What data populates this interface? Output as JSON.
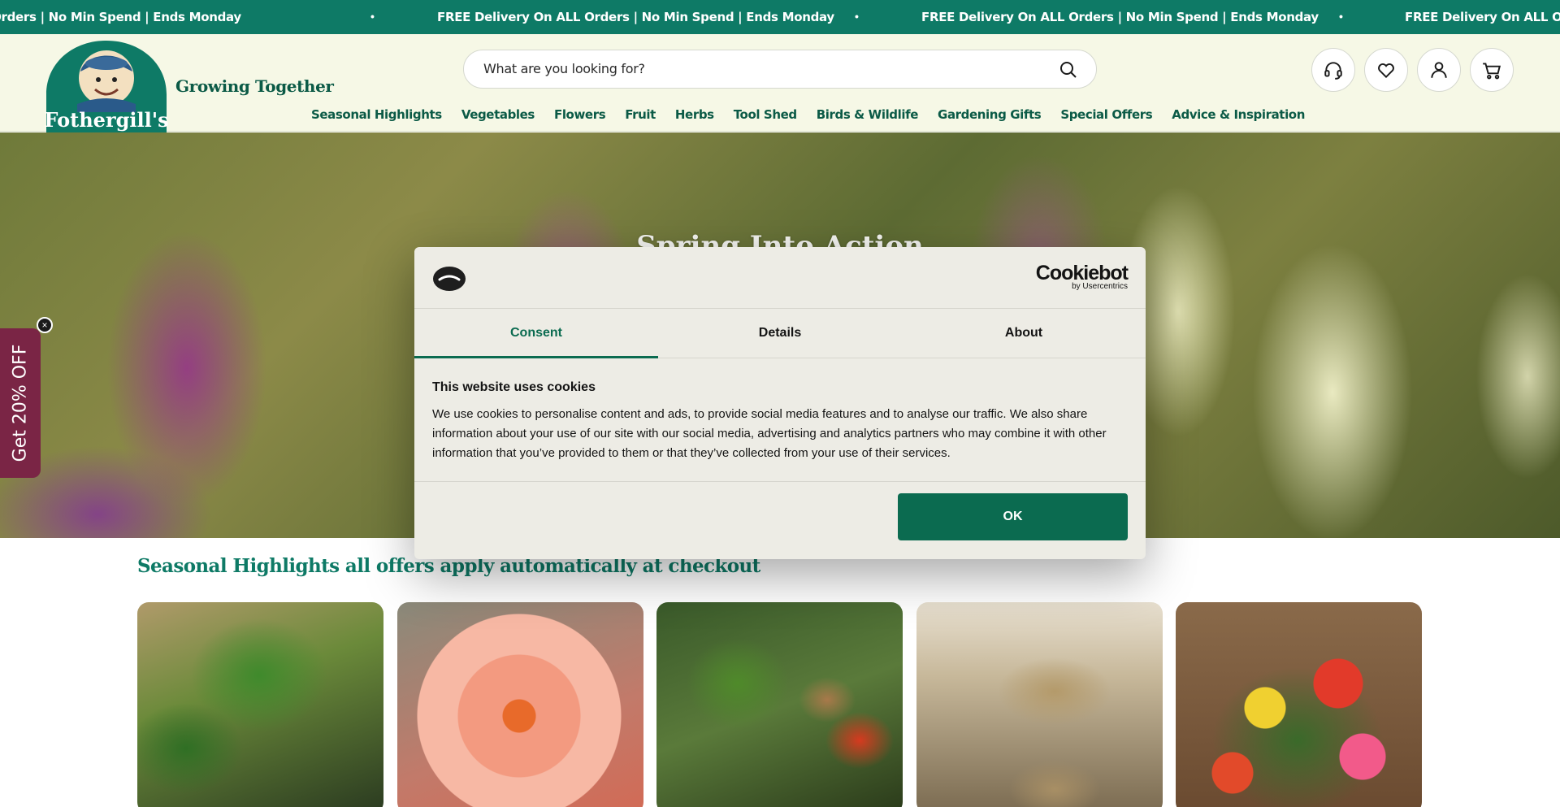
{
  "announcement": {
    "message": "FREE Delivery On ALL Orders | No Min Spend | Ends Monday",
    "separator": "•"
  },
  "header": {
    "logo_text": "Fothergill's",
    "tagline": "Growing Together",
    "search": {
      "placeholder": "What are you looking for?"
    },
    "icons": [
      "headset-icon",
      "heart-icon",
      "user-icon",
      "cart-icon"
    ]
  },
  "nav": {
    "items": [
      "Seasonal Highlights",
      "Vegetables",
      "Flowers",
      "Fruit",
      "Herbs",
      "Tool Shed",
      "Birds & Wildlife",
      "Gardening Gifts",
      "Special Offers",
      "Advice & Inspiration"
    ]
  },
  "hero": {
    "title": "Spring Into Action"
  },
  "side_tab": {
    "label": "Get 20% OFF",
    "close": "×"
  },
  "section": {
    "title": "Seasonal Highlights all offers apply automatically at checkout"
  },
  "cookie_banner": {
    "brand": "Cookiebot",
    "brand_sub": "by Usercentrics",
    "tabs": [
      "Consent",
      "Details",
      "About"
    ],
    "active_tab": "Consent",
    "heading": "This website uses cookies",
    "body": "We use cookies to personalise content and ads, to provide social media features and to analyse our traffic. We also share information about your use of our site with our social media, advertising and analytics partners who may combine it with other information that you’ve provided to them or that they’ve collected from your use of their services.",
    "ok_label": "OK"
  },
  "colors": {
    "brand_green": "#0e7a66",
    "dark_green": "#0b5a46",
    "cookie_accent": "#0b6b50",
    "header_bg": "#f6f8e6",
    "promo_tab": "#7a2545"
  }
}
